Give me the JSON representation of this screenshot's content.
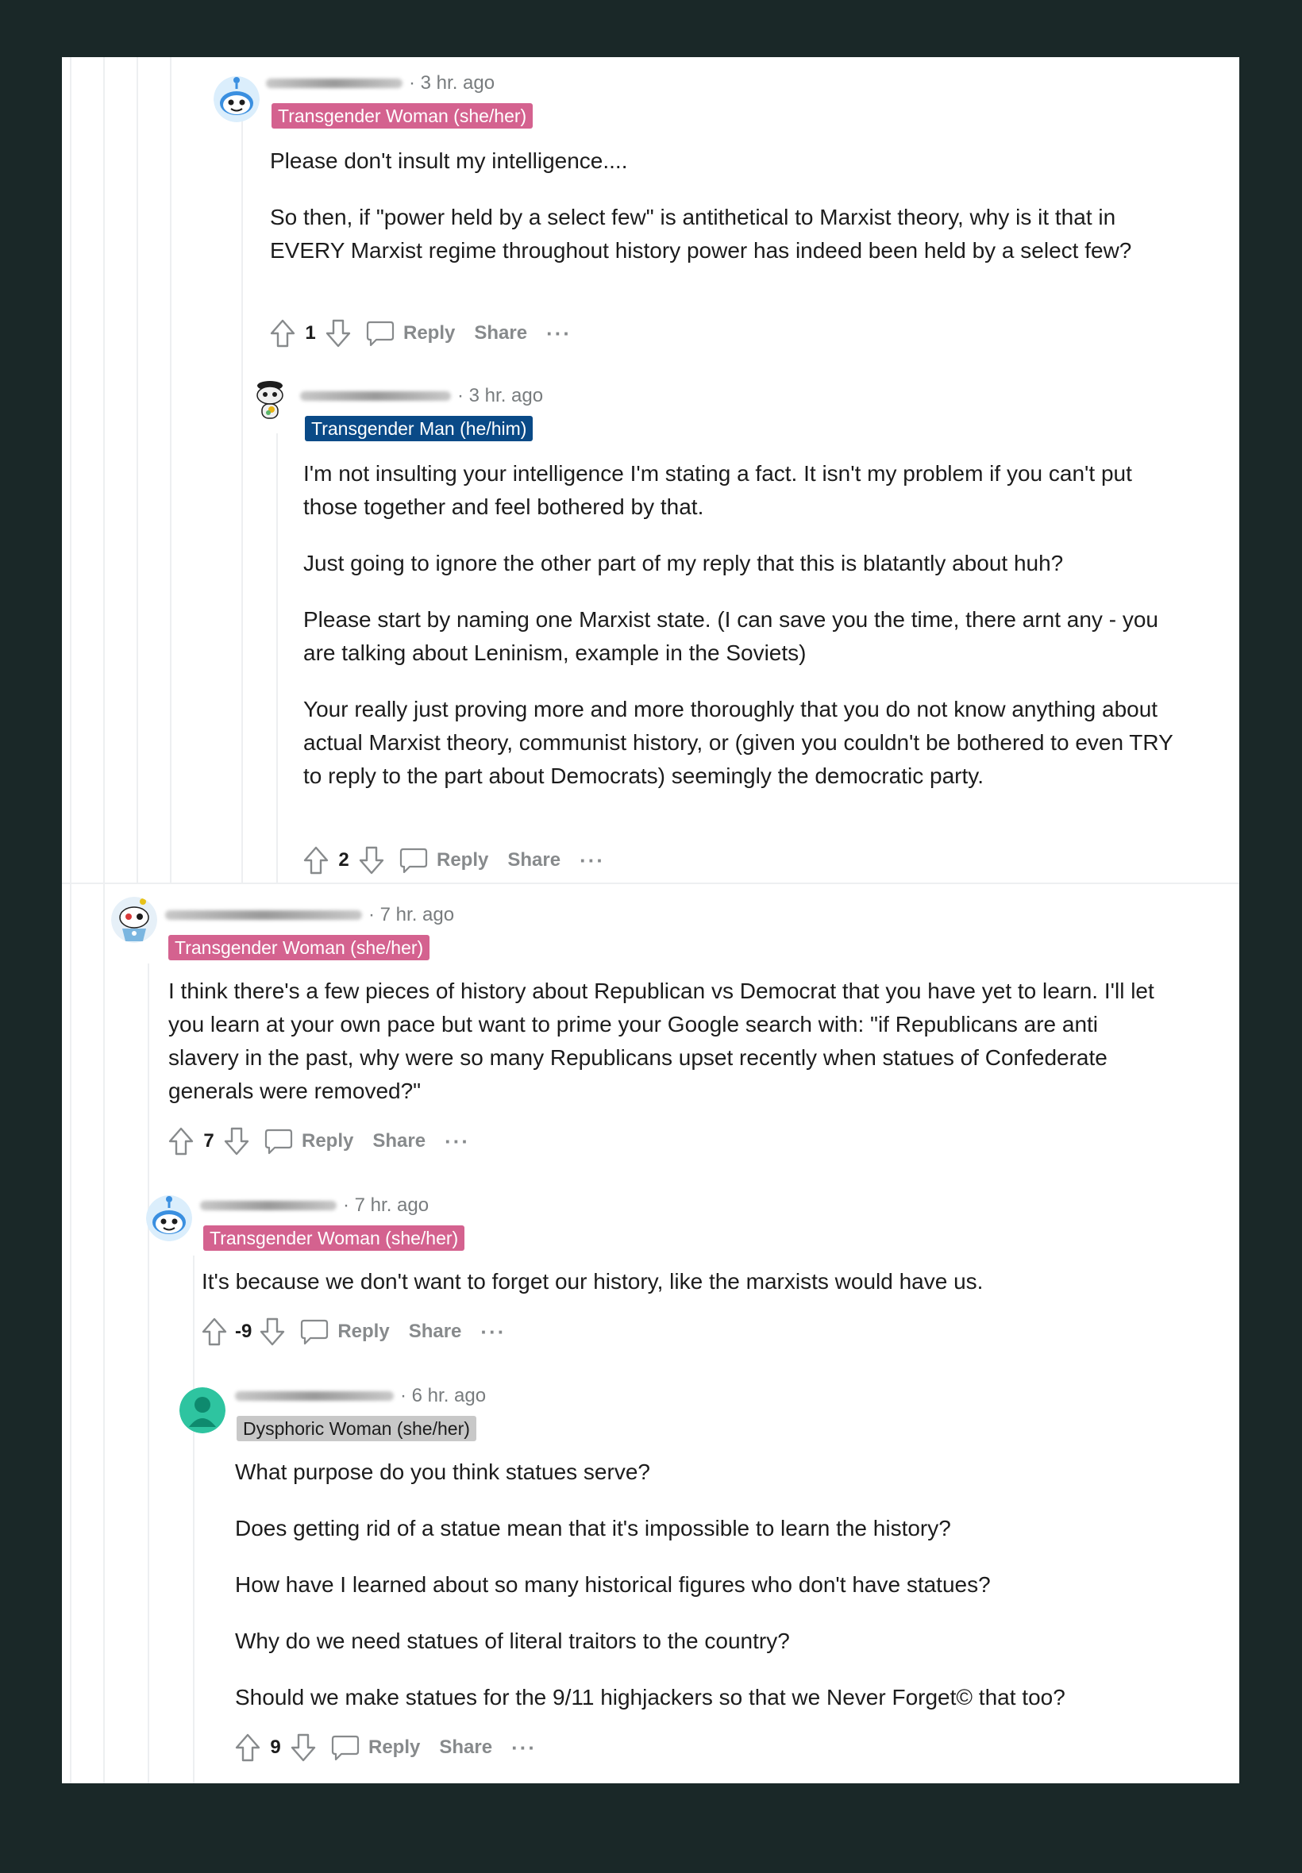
{
  "colors": {
    "background": "#1a2828",
    "card": "#ffffff",
    "flair_woman": "#d4628f",
    "flair_man": "#0a4a87",
    "flair_dysphoric": "#c8c8c8",
    "text": "#1c1c1c",
    "muted": "#787c7e"
  },
  "labels": {
    "reply": "Reply",
    "share": "Share",
    "more": "···"
  },
  "comments": [
    {
      "timestamp": "· 3 hr. ago",
      "flair": "Transgender Woman (she/her)",
      "paragraphs": [
        "Please don't insult my intelligence....",
        "So then, if \"power held by a select few\" is antithetical to Marxist theory, why is it that in EVERY Marxist regime throughout history power has indeed been held by a select few?"
      ],
      "score": "1",
      "avatar_icon": "snoo-avatar-icon"
    },
    {
      "timestamp": "· 3 hr. ago",
      "flair": "Transgender Man (he/him)",
      "paragraphs": [
        "I'm not insulting your intelligence I'm stating a fact. It isn't my problem if you can't put those together and feel bothered by that.",
        "Just going to ignore the other part of my reply that this is blatantly about huh?",
        "Please start by naming one Marxist state. (I can save you the time, there arnt any - you are talking about Leninism, example in the Soviets)",
        "Your really just proving more and more thoroughly that you do not know anything about actual Marxist theory, communist history, or (given you couldn't be bothered to even TRY to reply to the part about Democrats) seemingly the democratic party."
      ],
      "score": "2",
      "avatar_icon": "snoo-avatar-icon"
    },
    {
      "timestamp": "· 7 hr. ago",
      "flair": "Transgender Woman (she/her)",
      "paragraphs": [
        "I think there's a few pieces of history about Republican vs Democrat that you have yet to learn. I'll let you learn at your own pace but want to prime your Google search with: \"if Republicans are anti slavery in the past, why were so many Republicans upset recently when statues of Confederate generals were removed?\""
      ],
      "score": "7",
      "avatar_icon": "snoo-avatar-icon"
    },
    {
      "timestamp": "· 7 hr. ago",
      "flair": "Transgender Woman (she/her)",
      "paragraphs": [
        "It's because we don't want to forget our history, like the marxists would have us."
      ],
      "score": "-9",
      "avatar_icon": "snoo-avatar-icon"
    },
    {
      "timestamp": "· 6 hr. ago",
      "flair": "Dysphoric Woman (she/her)",
      "paragraphs": [
        "What purpose do you think statues serve?",
        "Does getting rid of a statue mean that it's impossible to learn the history?",
        "How have I learned about so many historical figures who don't have statues?",
        "Why do we need statues of literal traitors to the country?",
        "Should we make statues for the 9/11 highjackers so that we Never Forget© that too?"
      ],
      "score": "9",
      "avatar_icon": "default-user-icon"
    }
  ]
}
